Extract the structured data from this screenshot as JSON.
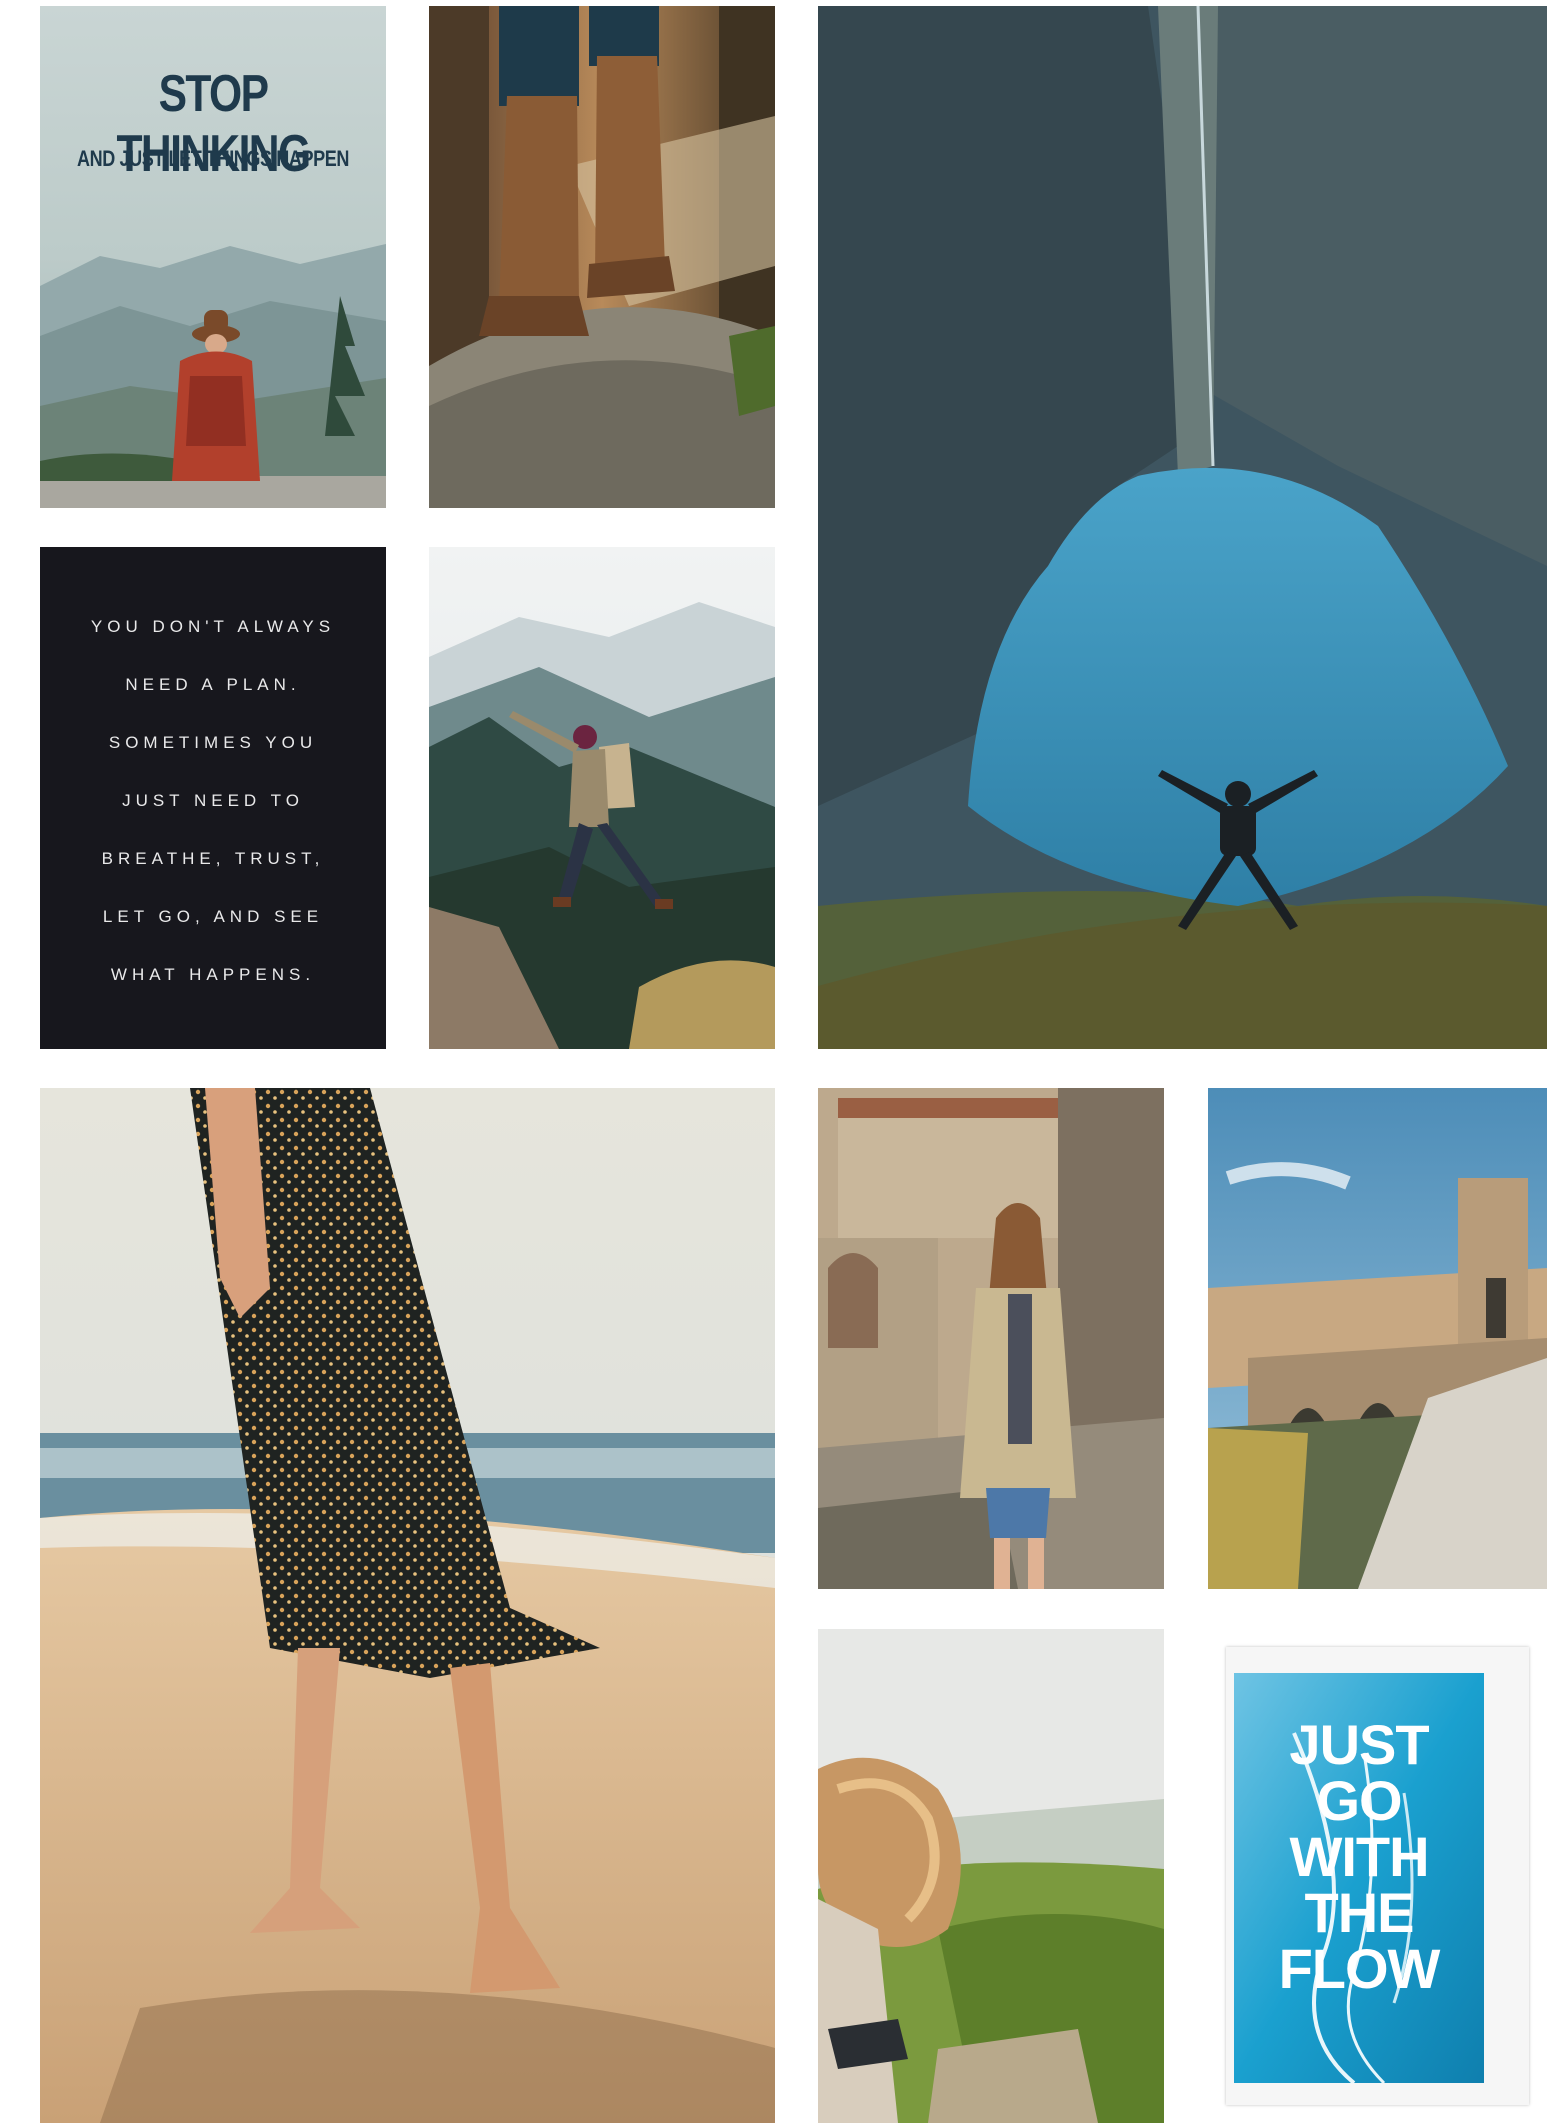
{
  "gallery": {
    "tiles": [
      {
        "kind": "poster",
        "lines": [
          "STOP THINKING",
          "AND JUST LET THINGS HAPPEN"
        ]
      },
      {
        "kind": "photo",
        "subject": "boots-on-log"
      },
      {
        "kind": "photo",
        "subject": "mountain-lake-jump"
      },
      {
        "kind": "poster",
        "lines": [
          "YOU DON'T ALWAYS",
          "NEED A PLAN.",
          "SOMETIMES YOU",
          "JUST NEED TO",
          "BREATHE, TRUST,",
          "LET GO, AND SEE",
          "WHAT HAPPENS."
        ]
      },
      {
        "kind": "photo",
        "subject": "hiker-leap"
      },
      {
        "kind": "photo",
        "subject": "beach-walk"
      },
      {
        "kind": "photo",
        "subject": "woman-old-village"
      },
      {
        "kind": "photo",
        "subject": "medieval-bridge"
      },
      {
        "kind": "photo",
        "subject": "windblown-hair"
      },
      {
        "kind": "poster",
        "lines": [
          "JUST",
          "GO",
          "WITH",
          "THE",
          "FLOW"
        ]
      }
    ]
  },
  "colors": {
    "poster_dark_bg": "#17171d",
    "poster_text_navy": "#1f3a4c",
    "flow_blue": "#1aa0cf",
    "lake_blue": "#3a95be",
    "page_bg": "#ffffff"
  }
}
